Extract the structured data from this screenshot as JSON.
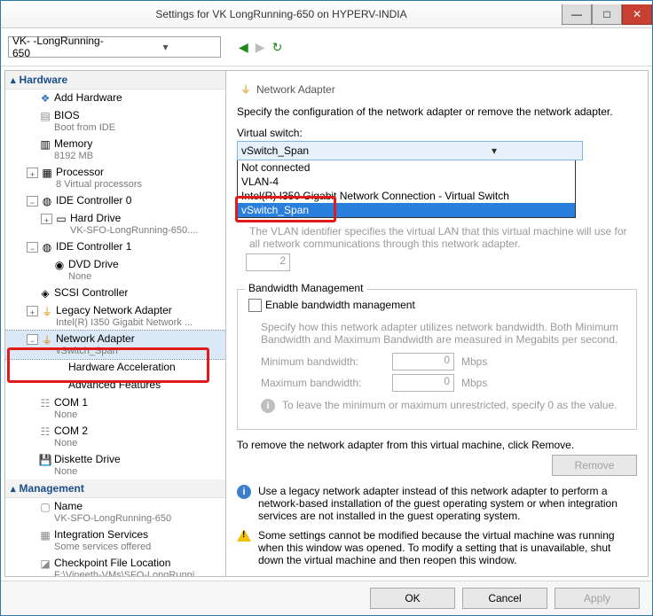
{
  "title": "Settings for VK       LongRunning-650 on HYPERV-INDIA",
  "vm_selector": "VK-     -LongRunning-650",
  "sections": {
    "hardware": "Hardware",
    "management": "Management"
  },
  "tree": {
    "add_hardware": "Add Hardware",
    "bios": "BIOS",
    "bios_sub": "Boot from IDE",
    "memory": "Memory",
    "memory_sub": "8192 MB",
    "processor": "Processor",
    "processor_sub": "8 Virtual processors",
    "ide0": "IDE Controller 0",
    "hard_drive": "Hard Drive",
    "hard_drive_sub": "VK-SFO-LongRunning-650....",
    "ide1": "IDE Controller 1",
    "dvd": "DVD Drive",
    "dvd_sub": "None",
    "scsi": "SCSI Controller",
    "legacy_net": "Legacy Network Adapter",
    "legacy_net_sub": "Intel(R) I350 Gigabit Network ...",
    "net_adapter": "Network Adapter",
    "net_adapter_sub": "vSwitch_Span",
    "hw_accel": "Hardware Acceleration",
    "adv_feat": "Advanced Features",
    "com1": "COM 1",
    "com1_sub": "None",
    "com2": "COM 2",
    "com2_sub": "None",
    "diskette": "Diskette Drive",
    "diskette_sub": "None",
    "name": "Name",
    "name_sub": "VK-SFO-LongRunning-650",
    "integ": "Integration Services",
    "integ_sub": "Some services offered",
    "checkpoint": "Checkpoint File Location",
    "checkpoint_sub": "F:\\Vineeth-VMs\\SFO-LongRunni..."
  },
  "detail": {
    "header": "Network Adapter",
    "desc": "Specify the configuration of the network adapter or remove the network adapter.",
    "vswitch_label": "Virtual switch:",
    "vswitch_value": "vSwitch_Span",
    "options": [
      "Not connected",
      "VLAN-4",
      "Intel(R) I350 Gigabit Network Connection - Virtual Switch",
      "vSwitch_Span"
    ],
    "vlan_hint": "The VLAN identifier specifies the virtual LAN that this virtual machine will use for all network communications through this network adapter.",
    "vlan_value": "2",
    "bw_legend": "Bandwidth Management",
    "bw_enable": "Enable bandwidth management",
    "bw_hint": "Specify how this network adapter utilizes network bandwidth. Both Minimum Bandwidth and Maximum Bandwidth are measured in Megabits per second.",
    "bw_min_label": "Minimum bandwidth:",
    "bw_max_label": "Maximum bandwidth:",
    "bw_min": "0",
    "bw_max": "0",
    "mbps": "Mbps",
    "bw_zero_hint": "To leave the minimum or maximum unrestricted, specify 0 as the value.",
    "remove_desc": "To remove the network adapter from this virtual machine, click Remove.",
    "remove_btn": "Remove",
    "legacy_info": "Use a legacy network adapter instead of this network adapter to perform a network-based installation of the guest operating system or when integration services are not installed in the guest operating system.",
    "warn_info": "Some settings cannot be modified because the virtual machine was running when this window was opened. To modify a setting that is unavailable, shut down the virtual machine and then reopen this window."
  },
  "buttons": {
    "ok": "OK",
    "cancel": "Cancel",
    "apply": "Apply"
  }
}
